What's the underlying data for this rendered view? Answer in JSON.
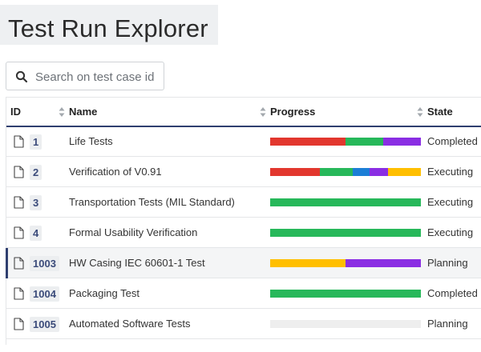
{
  "page": {
    "title": "Test Run Explorer"
  },
  "search": {
    "placeholder": "Search on test case id"
  },
  "colors": {
    "red": "#e2372e",
    "green": "#27b85a",
    "blue": "#1c7ed6",
    "purple": "#8a2ee3",
    "yellow": "#ffbf00",
    "empty": "#eeeeee",
    "accent": "#2f3f6f"
  },
  "table": {
    "columns": {
      "id": "ID",
      "name": "Name",
      "progress": "Progress",
      "state": "State"
    },
    "rows": [
      {
        "id": "1",
        "name": "Life Tests",
        "state": "Completed",
        "selected": false,
        "progress": [
          {
            "color": "red",
            "fraction": 0.5
          },
          {
            "color": "green",
            "fraction": 0.25
          },
          {
            "color": "purple",
            "fraction": 0.25
          }
        ]
      },
      {
        "id": "2",
        "name": "Verification of V0.91",
        "state": "Executing",
        "selected": false,
        "progress": [
          {
            "color": "red",
            "fraction": 0.33
          },
          {
            "color": "green",
            "fraction": 0.22
          },
          {
            "color": "blue",
            "fraction": 0.11
          },
          {
            "color": "purple",
            "fraction": 0.12
          },
          {
            "color": "yellow",
            "fraction": 0.22
          }
        ]
      },
      {
        "id": "3",
        "name": "Transportation Tests (MIL Standard)",
        "state": "Executing",
        "selected": false,
        "progress": [
          {
            "color": "green",
            "fraction": 1.0
          }
        ]
      },
      {
        "id": "4",
        "name": "Formal Usability Verification",
        "state": "Executing",
        "selected": false,
        "progress": [
          {
            "color": "green",
            "fraction": 1.0
          }
        ]
      },
      {
        "id": "1003",
        "name": "HW Casing IEC 60601-1 Test",
        "state": "Planning",
        "selected": true,
        "progress": [
          {
            "color": "yellow",
            "fraction": 0.5
          },
          {
            "color": "purple",
            "fraction": 0.5
          }
        ]
      },
      {
        "id": "1004",
        "name": "Packaging Test",
        "state": "Completed",
        "selected": false,
        "progress": [
          {
            "color": "green",
            "fraction": 1.0
          }
        ]
      },
      {
        "id": "1005",
        "name": "Automated Software Tests",
        "state": "Planning",
        "selected": false,
        "progress": []
      }
    ]
  }
}
